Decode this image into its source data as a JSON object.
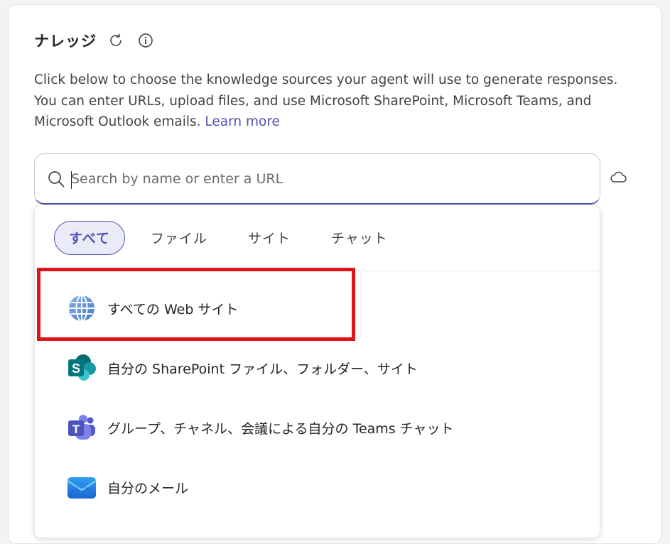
{
  "header": {
    "title": "ナレッジ"
  },
  "description": {
    "text": "Click below to choose the knowledge sources your agent will use to generate responses. You can enter URLs, upload files, and use Microsoft SharePoint, Microsoft Teams, and Microsoft Outlook emails.",
    "link": "Learn more"
  },
  "search": {
    "placeholder": "Search by name or enter a URL"
  },
  "tabs": [
    {
      "label": "すべて",
      "active": true
    },
    {
      "label": "ファイル"
    },
    {
      "label": "サイト"
    },
    {
      "label": "チャット"
    }
  ],
  "options": [
    {
      "label": "すべての Web サイト",
      "icon": "globe-icon"
    },
    {
      "label": "自分の SharePoint ファイル、フォルダー、サイト",
      "icon": "sharepoint-icon"
    },
    {
      "label": "グループ、チャネル、会議による自分の Teams チャット",
      "icon": "teams-icon"
    },
    {
      "label": "自分のメール",
      "icon": "outlook-mail-icon"
    }
  ],
  "colors": {
    "accent": "#4f52b2",
    "highlight": "#e0131a"
  }
}
